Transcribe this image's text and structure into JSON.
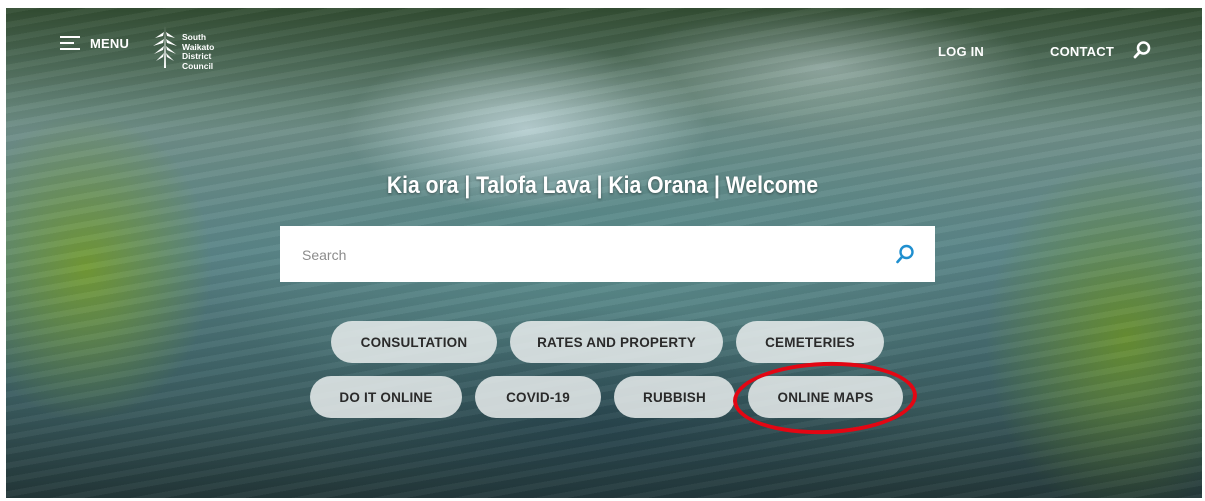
{
  "header": {
    "menu_label": "MENU",
    "logo_lines": [
      "South",
      "Waikato",
      "District",
      "Council"
    ],
    "login_label": "LOG IN",
    "contact_label": "CONTACT",
    "search_icon": "search-icon"
  },
  "hero": {
    "welcome_text": "Kia ora | Talofa Lava | Kia Orana | Welcome",
    "search_placeholder": "Search"
  },
  "quick_links": {
    "row1": [
      "CONSULTATION",
      "RATES AND PROPERTY",
      "CEMETERIES"
    ],
    "row2": [
      "DO IT ONLINE",
      "COVID-19",
      "RUBBISH",
      "ONLINE MAPS"
    ]
  },
  "colors": {
    "accent_search": "#1f8fcf",
    "highlight_circle": "#e30613",
    "pill_bg": "#e8ecec"
  }
}
